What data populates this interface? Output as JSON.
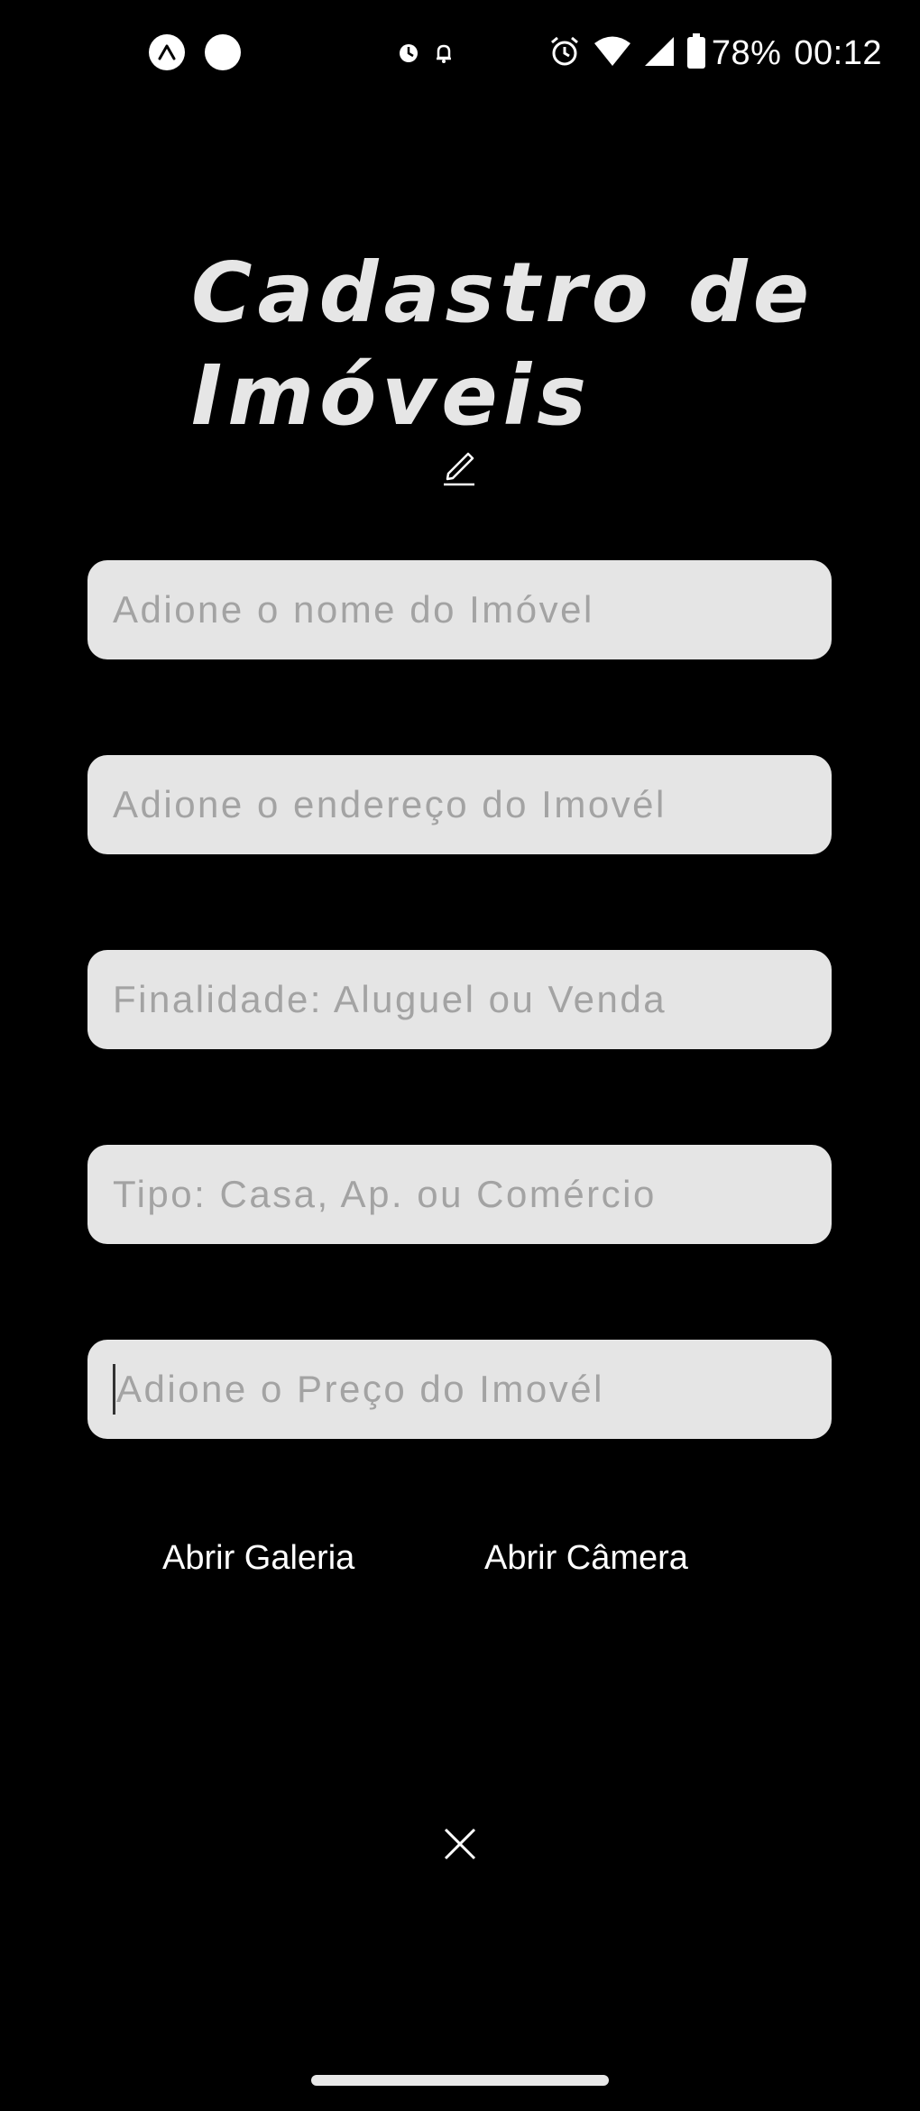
{
  "status_bar": {
    "left_icons": [
      "expo-icon",
      "circle-icon"
    ],
    "notification_icons": [
      "data-saver-icon",
      "bell-icon"
    ],
    "right_icons": [
      "alarm-icon",
      "wifi-icon",
      "signal-icon",
      "battery-icon"
    ],
    "battery_percent": "78%",
    "clock": "00:12"
  },
  "header": {
    "title": "Cadastro de Imóveis"
  },
  "form": {
    "fields": [
      {
        "placeholder": "Adione o nome do Imóvel"
      },
      {
        "placeholder": "Adione o endereço do Imovél"
      },
      {
        "placeholder": "Finalidade: Aluguel ou Venda"
      },
      {
        "placeholder": "Tipo: Casa, Ap. ou Comércio"
      },
      {
        "placeholder": "Adione o Preço do Imovél",
        "focused": true
      }
    ]
  },
  "actions": {
    "gallery_label": "Abrir Galeria",
    "camera_label": "Abrir Câmera"
  },
  "colors": {
    "background": "#000000",
    "input_background": "#e5e5e5",
    "placeholder": "#a3a3a3",
    "title": "#e6e6e6"
  }
}
